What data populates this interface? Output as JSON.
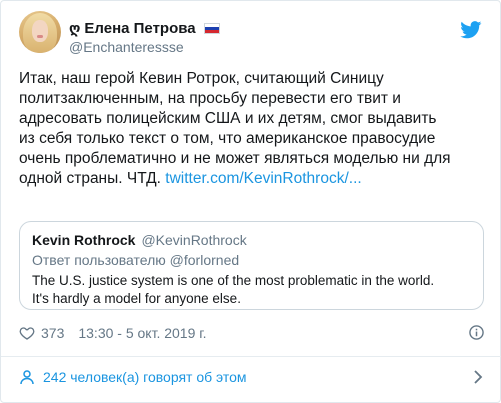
{
  "author": {
    "glyph": "ღ",
    "display_name": "Елена Петрова",
    "handle": "@Enchanteressse"
  },
  "tweet": {
    "lines": [
      "Итак, наш герой Кевин Ротрок, считающий Синицу",
      "политзаключенным, на просьбу перевести его твит и",
      "адресовать полицейским США и их детям, смог выдавить",
      "из себя только текст о том, что американское правосудие",
      "очень проблематично и не может являться моделью ни для",
      "одной страны. ЧТД."
    ],
    "link": "twitter.com/KevinRothrock/..."
  },
  "quote": {
    "name": "Kevin Rothrock",
    "handle": "@KevinRothrock",
    "reply": "Ответ пользователю @forlorned",
    "lines": [
      "The U.S. justice system is one of the most problematic in the world.",
      "It's hardly a model for anyone else."
    ]
  },
  "meta": {
    "likes": "373",
    "timestamp": "13:30 - 5 окт. 2019 г."
  },
  "footer": {
    "people_text": "242 человек(а) говорят об этом"
  },
  "colors": {
    "accent": "#1b95e0",
    "text": "#14171a",
    "muted": "#657786",
    "border": "#ccd6dd"
  },
  "icons": {
    "brand": "twitter-bird-icon",
    "like": "heart-icon",
    "info": "info-icon",
    "people": "person-icon",
    "more": "chevron-right-icon"
  }
}
